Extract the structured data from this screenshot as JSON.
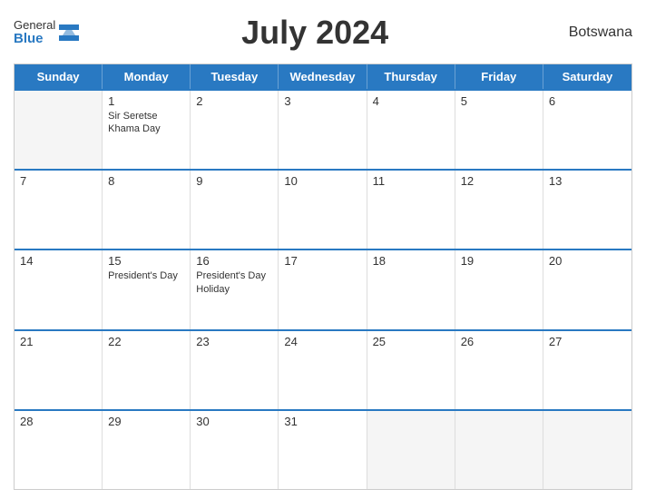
{
  "logo": {
    "line1": "General",
    "line2": "Blue"
  },
  "title": "July 2024",
  "country": "Botswana",
  "header": {
    "days": [
      "Sunday",
      "Monday",
      "Tuesday",
      "Wednesday",
      "Thursday",
      "Friday",
      "Saturday"
    ]
  },
  "weeks": [
    [
      {
        "day": "",
        "events": [],
        "empty": true
      },
      {
        "day": "1",
        "events": [
          "Sir Seretse Khama Day"
        ],
        "empty": false
      },
      {
        "day": "2",
        "events": [],
        "empty": false
      },
      {
        "day": "3",
        "events": [],
        "empty": false
      },
      {
        "day": "4",
        "events": [],
        "empty": false
      },
      {
        "day": "5",
        "events": [],
        "empty": false
      },
      {
        "day": "6",
        "events": [],
        "empty": false
      }
    ],
    [
      {
        "day": "7",
        "events": [],
        "empty": false
      },
      {
        "day": "8",
        "events": [],
        "empty": false
      },
      {
        "day": "9",
        "events": [],
        "empty": false
      },
      {
        "day": "10",
        "events": [],
        "empty": false
      },
      {
        "day": "11",
        "events": [],
        "empty": false
      },
      {
        "day": "12",
        "events": [],
        "empty": false
      },
      {
        "day": "13",
        "events": [],
        "empty": false
      }
    ],
    [
      {
        "day": "14",
        "events": [],
        "empty": false
      },
      {
        "day": "15",
        "events": [
          "President's Day"
        ],
        "empty": false
      },
      {
        "day": "16",
        "events": [
          "President's Day Holiday"
        ],
        "empty": false
      },
      {
        "day": "17",
        "events": [],
        "empty": false
      },
      {
        "day": "18",
        "events": [],
        "empty": false
      },
      {
        "day": "19",
        "events": [],
        "empty": false
      },
      {
        "day": "20",
        "events": [],
        "empty": false
      }
    ],
    [
      {
        "day": "21",
        "events": [],
        "empty": false
      },
      {
        "day": "22",
        "events": [],
        "empty": false
      },
      {
        "day": "23",
        "events": [],
        "empty": false
      },
      {
        "day": "24",
        "events": [],
        "empty": false
      },
      {
        "day": "25",
        "events": [],
        "empty": false
      },
      {
        "day": "26",
        "events": [],
        "empty": false
      },
      {
        "day": "27",
        "events": [],
        "empty": false
      }
    ],
    [
      {
        "day": "28",
        "events": [],
        "empty": false
      },
      {
        "day": "29",
        "events": [],
        "empty": false
      },
      {
        "day": "30",
        "events": [],
        "empty": false
      },
      {
        "day": "31",
        "events": [],
        "empty": false
      },
      {
        "day": "",
        "events": [],
        "empty": true
      },
      {
        "day": "",
        "events": [],
        "empty": true
      },
      {
        "day": "",
        "events": [],
        "empty": true
      }
    ]
  ]
}
